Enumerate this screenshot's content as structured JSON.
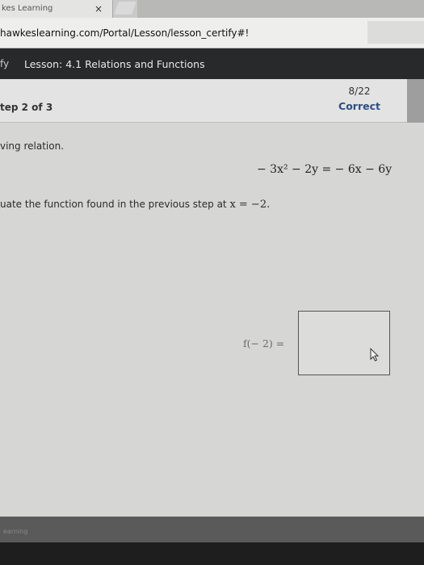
{
  "browser": {
    "tab_title": "kes Learning",
    "tab_close_glyph": "×",
    "url": "hawkeslearning.com/Portal/Lesson/lesson_certify#!"
  },
  "header": {
    "mode_label": "fy",
    "lesson_title": "Lesson: 4.1 Relations and Functions"
  },
  "step": {
    "label": "tep 2 of 3",
    "score": "8/22",
    "status": "Correct"
  },
  "problem": {
    "prompt": "ving relation.",
    "equation": "− 3x² − 2y = − 6x − 6y",
    "instruction_text": "uate the function found in the previous step at ",
    "instruction_math": "x = −2."
  },
  "answer": {
    "label": "f(− 2) =",
    "value": ""
  },
  "footer": {
    "brand": "earning"
  },
  "colors": {
    "lesson_bar": "#27292b",
    "status_correct": "#2f4e86"
  }
}
